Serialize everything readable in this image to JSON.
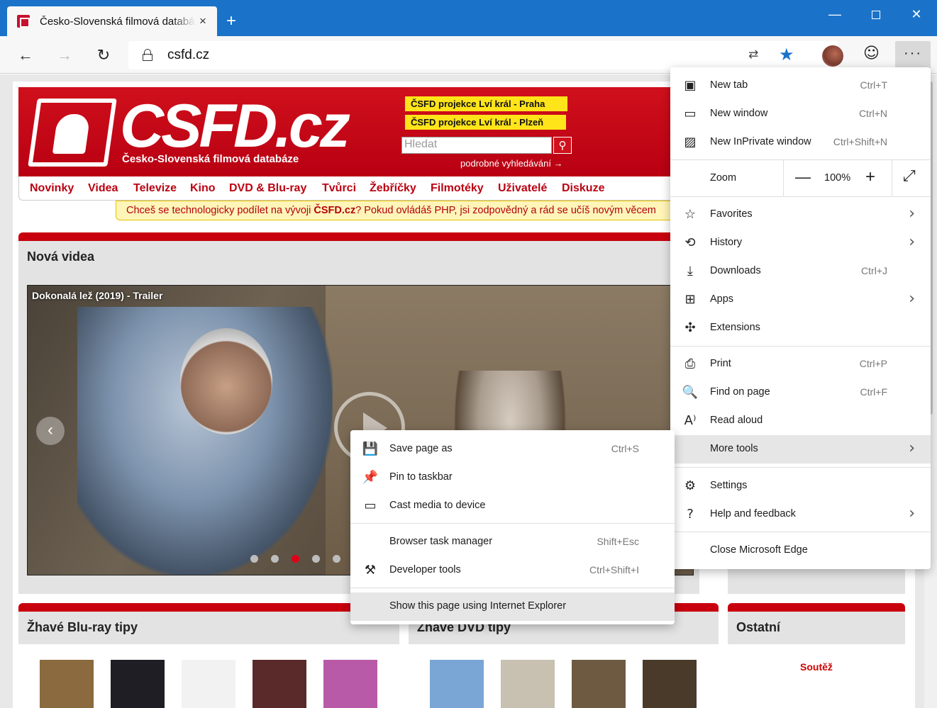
{
  "browser": {
    "tab_title": "Česko-Slovenská filmová databáze",
    "tab_close": "×",
    "new_tab": "+",
    "window_min": "—",
    "window_close": "✕",
    "nav_back": "←",
    "nav_forward": "→",
    "nav_refresh": "↻",
    "url": "csfd.cz",
    "translate_glyph": "⇄",
    "favorite_glyph": "★",
    "feedback_glyph": "☺",
    "menu_glyph": "···"
  },
  "site": {
    "logo_text": "CSFD.cz",
    "logo_subtitle": "Česko-Slovenská filmová databáze",
    "promo1": "ČSFD projekce Lví král - Praha",
    "promo2": "ČSFD projekce Lví král - Plzeň",
    "search_placeholder": "Hledat",
    "advanced_search": "podrobné vyhledávání →",
    "nav": [
      "Novinky",
      "Videa",
      "Televize",
      "Kino",
      "DVD & Blu-ray",
      "Tvůrci",
      "Žebříčky",
      "Filmotéky",
      "Uživatelé",
      "Diskuze"
    ],
    "notice_text": "Chceš se technologicky podílet na vývoji ",
    "notice_brand": "ČSFD.cz",
    "notice_rest": "? Pokud ovládáš PHP, jsi zodpovědný a rád se učíš novým věcem",
    "videos_heading": "Nová videa",
    "video_title": "Dokonalá lež (2019) - Trailer",
    "prev_arrow": "‹",
    "slider_dots": 5,
    "slider_active_index": 2,
    "bluray_heading": "Žhavé Blu-ray tipy",
    "dvd_heading": "Žhavé DVD tipy",
    "other_heading": "Ostatní",
    "contest_label": "Soutěž",
    "poster_colors": [
      "#8a6a3e",
      "#1e1e24",
      "#f2f2f2",
      "#5a2a2a",
      "#b85aa8",
      "#7aa6d6",
      "#c8c0b0",
      "#6e5a40",
      "#4a3a2a"
    ]
  },
  "menu": {
    "items": {
      "new_tab": {
        "label": "New tab",
        "shortcut": "Ctrl+T",
        "icon": "new-tab-icon"
      },
      "new_window": {
        "label": "New window",
        "shortcut": "Ctrl+N",
        "icon": "new-window-icon"
      },
      "inprivate": {
        "label": "New InPrivate window",
        "shortcut": "Ctrl+Shift+N",
        "icon": "inprivate-icon"
      },
      "zoom": {
        "label": "Zoom",
        "minus": "—",
        "value": "100%",
        "plus": "+",
        "fullscreen": "⤢"
      },
      "favorites": {
        "label": "Favorites",
        "icon": "☆"
      },
      "history": {
        "label": "History",
        "icon": "⟲"
      },
      "downloads": {
        "label": "Downloads",
        "shortcut": "Ctrl+J",
        "icon": "⤓"
      },
      "apps": {
        "label": "Apps",
        "icon": "⊞"
      },
      "extensions": {
        "label": "Extensions",
        "icon": "✣"
      },
      "print": {
        "label": "Print",
        "shortcut": "Ctrl+P",
        "icon": "⎙"
      },
      "find": {
        "label": "Find on page",
        "shortcut": "Ctrl+F",
        "icon": "🔍"
      },
      "read_aloud": {
        "label": "Read aloud",
        "icon": "A⁾"
      },
      "more_tools": {
        "label": "More tools"
      },
      "settings": {
        "label": "Settings",
        "icon": "⚙"
      },
      "help": {
        "label": "Help and feedback",
        "icon": "?"
      },
      "close": {
        "label": "Close Microsoft Edge"
      }
    },
    "chevron": "›"
  },
  "submenu": {
    "save_page": {
      "label": "Save page as",
      "shortcut": "Ctrl+S",
      "icon": "💾"
    },
    "pin": {
      "label": "Pin to taskbar",
      "icon": "📌"
    },
    "cast": {
      "label": "Cast media to device",
      "icon": "▭"
    },
    "task_manager": {
      "label": "Browser task manager",
      "shortcut": "Shift+Esc"
    },
    "dev_tools": {
      "label": "Developer tools",
      "shortcut": "Ctrl+Shift+I",
      "icon": "⚒"
    },
    "ie_mode": {
      "label": "Show this page using Internet Explorer"
    }
  }
}
